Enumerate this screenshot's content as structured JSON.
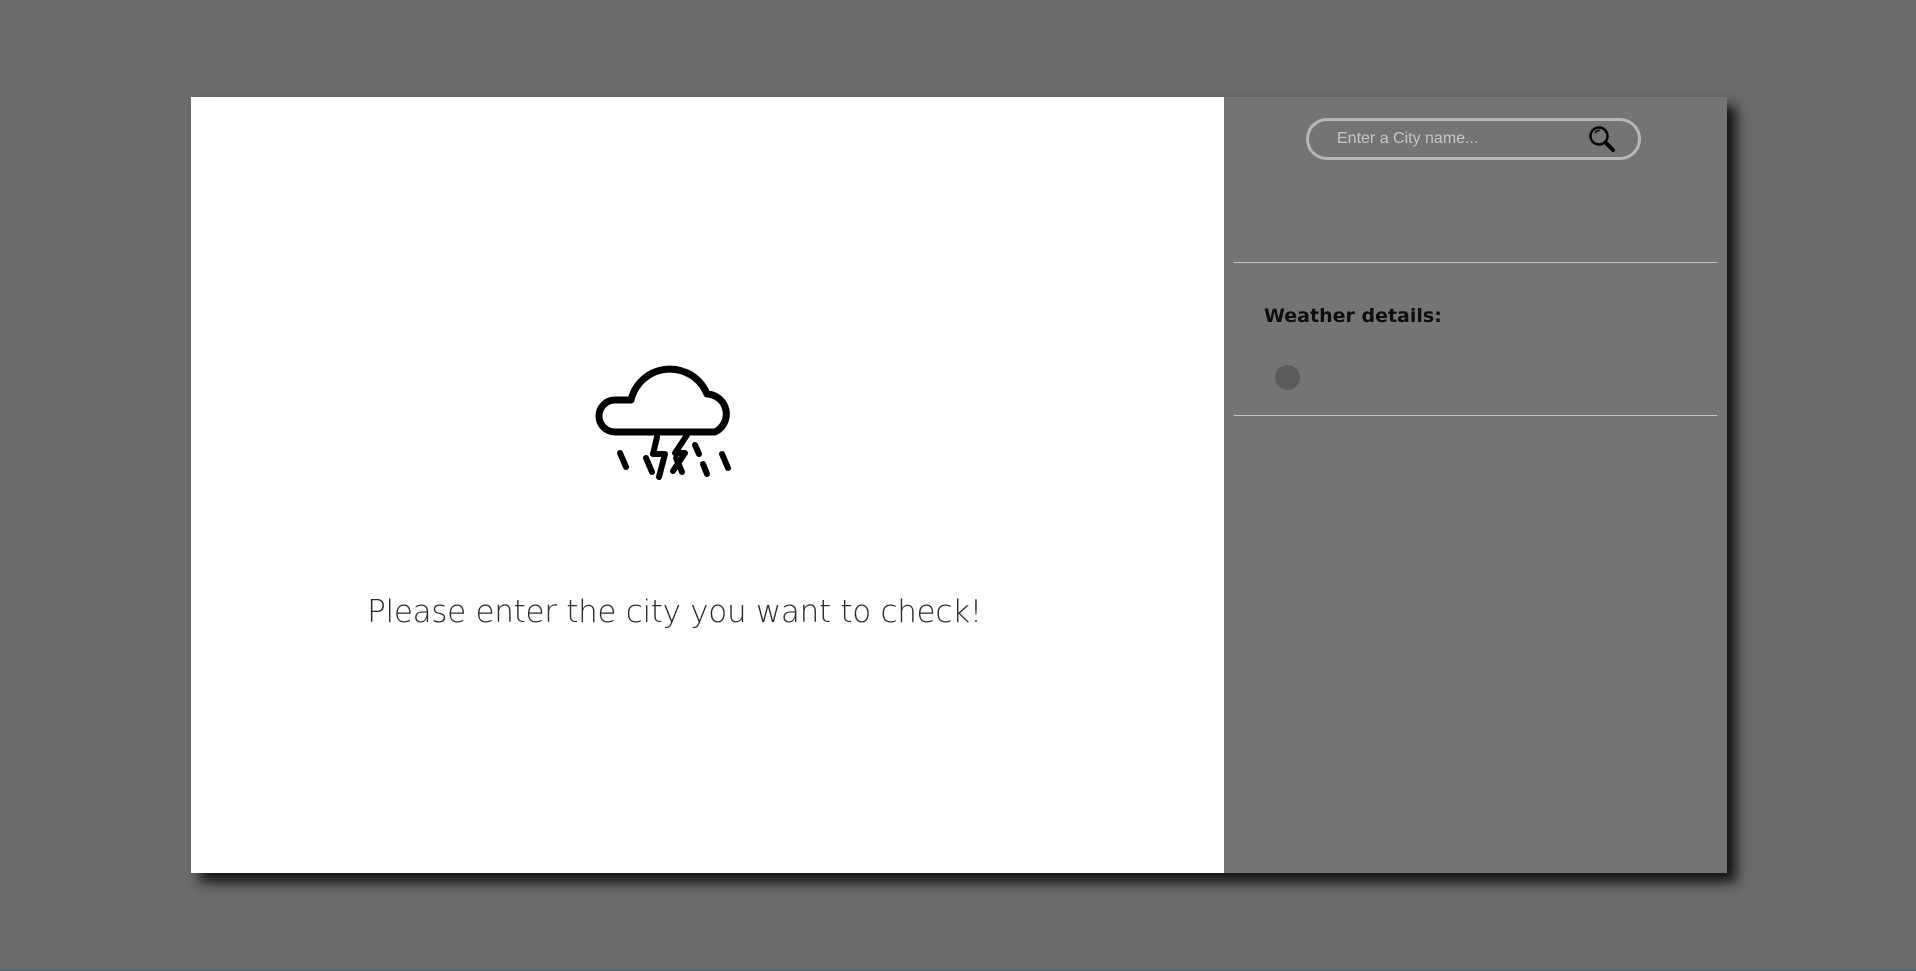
{
  "main": {
    "icon": "thunderstorm-rain-icon",
    "prompt": "Please enter the city you want to check!"
  },
  "sidebar": {
    "search": {
      "placeholder": "Enter a City name...",
      "value": "",
      "icon": "search-icon"
    },
    "details": {
      "title": "Weather details:",
      "items": []
    }
  },
  "colors": {
    "page_background": "#6b6b6b",
    "main_panel": "#ffffff",
    "side_panel": "#747474",
    "search_border": "#b7b7b7",
    "divider": "#c4c4c4",
    "bullet": "#5b5b5b"
  }
}
